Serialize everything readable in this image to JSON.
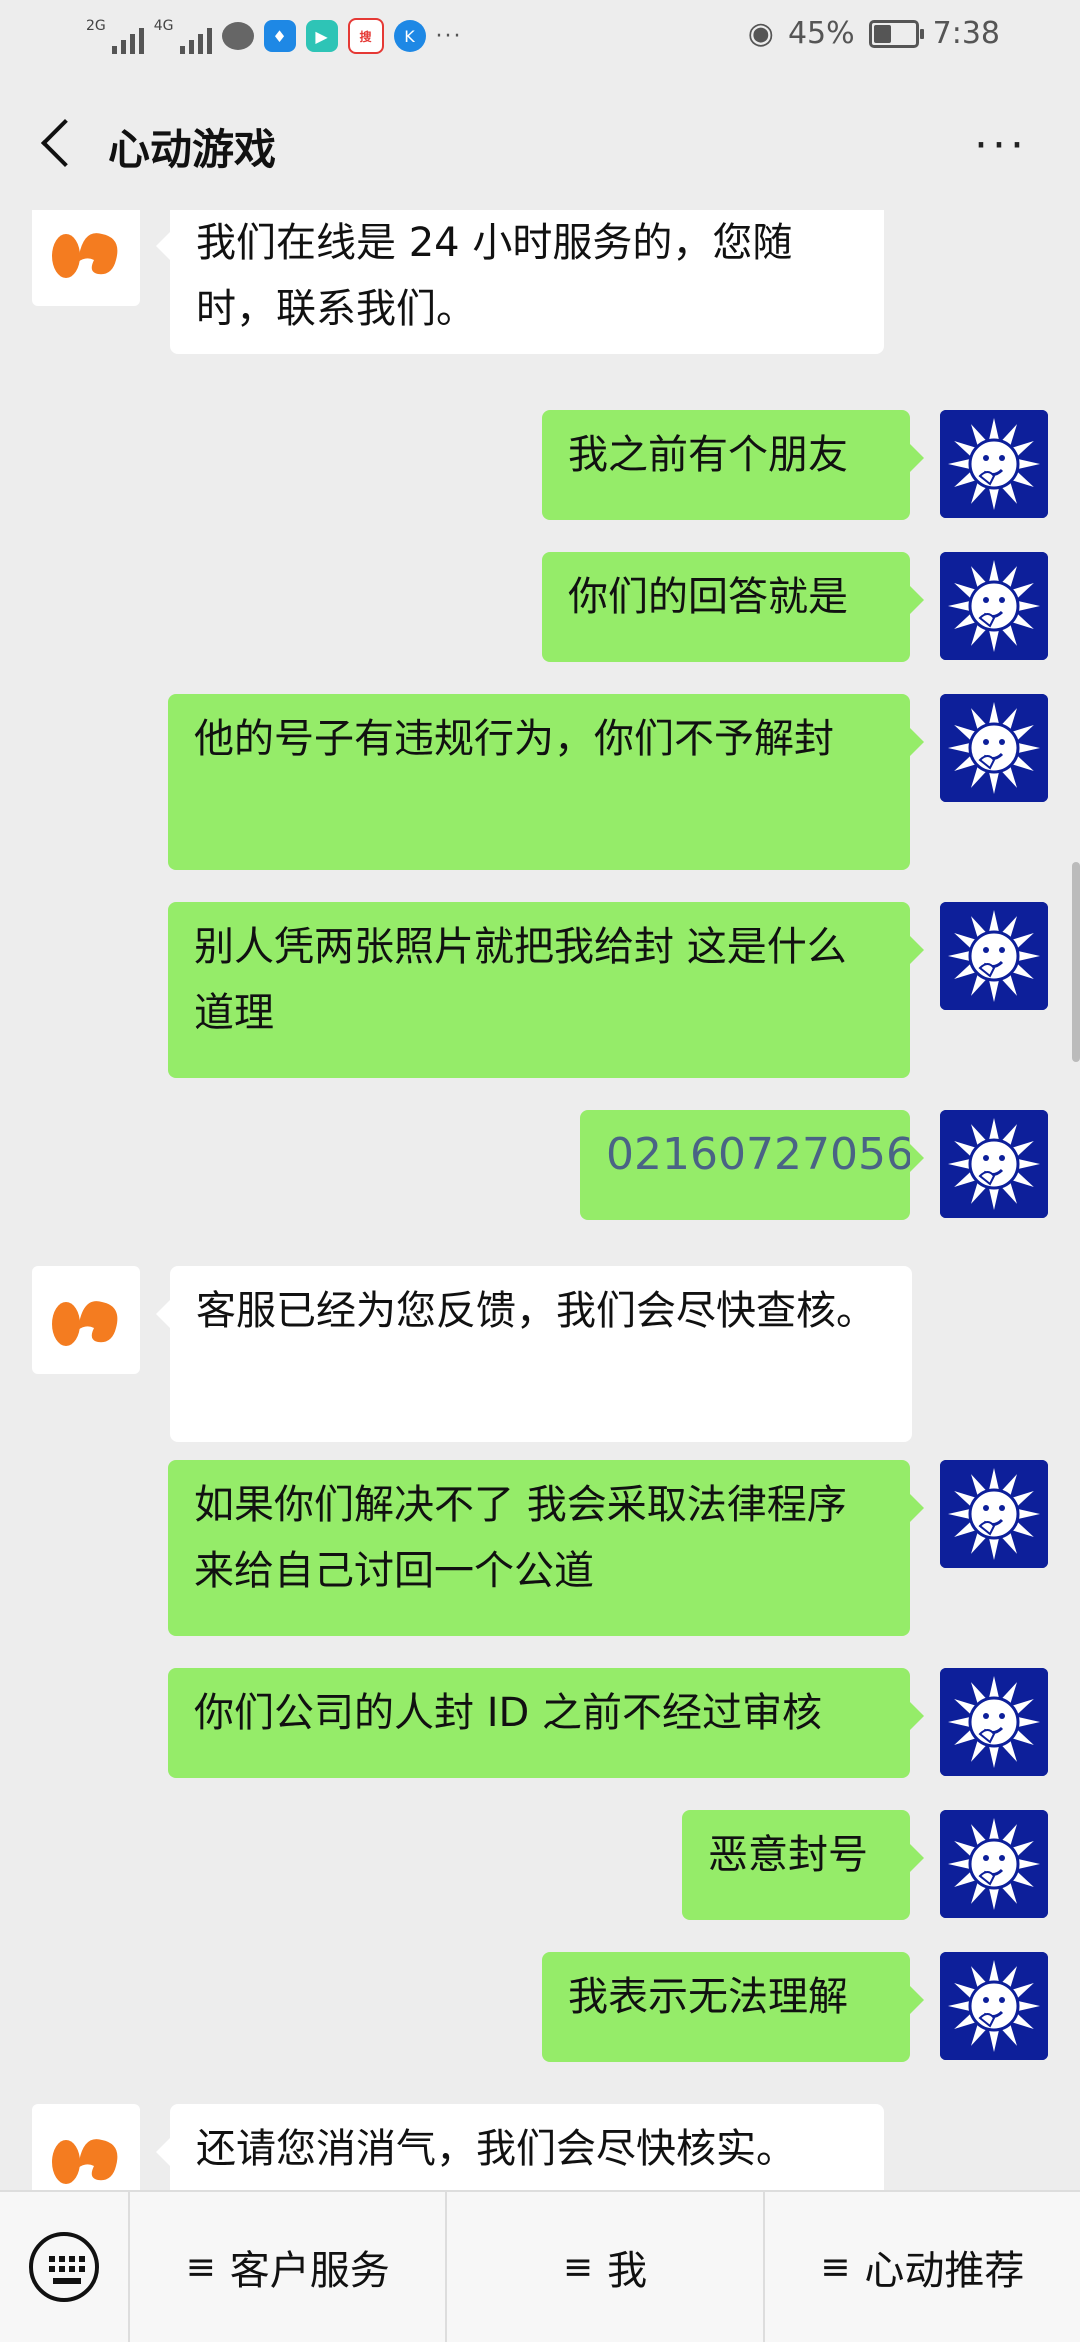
{
  "status": {
    "signal1": "2G",
    "signal2": "4G",
    "battery_pct": "45%",
    "battery_level": 0.45,
    "time": "7:38",
    "more": "···",
    "news_icon_text": "搜狐视频"
  },
  "header": {
    "title": "心动游戏",
    "more_label": "···"
  },
  "messages": [
    {
      "side": "in",
      "text": "我们在线是 24 小时服务的，您随时，联系我们。"
    },
    {
      "side": "out",
      "text": "我之前有个朋友"
    },
    {
      "side": "out",
      "text": "你们的回答就是"
    },
    {
      "side": "out",
      "text": "他的号子有违规行为，你们不予解封"
    },
    {
      "side": "out",
      "text": "别人凭两张照片就把我给封 这是什么道理"
    },
    {
      "side": "out",
      "text": "02160727056"
    },
    {
      "side": "in",
      "text": "客服已经为您反馈，我们会尽快查核。"
    },
    {
      "side": "out",
      "text": "如果你们解决不了 我会采取法律程序来给自己讨回一个公道"
    },
    {
      "side": "out",
      "text": "你们公司的人封 ID 之前不经过审核"
    },
    {
      "side": "out",
      "text": "恶意封号"
    },
    {
      "side": "out",
      "text": "我表示无法理解"
    },
    {
      "side": "in",
      "text": "还请您消消气，我们会尽快核实。"
    }
  ],
  "menu": {
    "items": [
      {
        "label": "客户服务"
      },
      {
        "label": "我"
      },
      {
        "label": "心动推荐"
      }
    ],
    "hamburger": "≡"
  },
  "colors": {
    "background": "#ededed",
    "outgoing_bubble": "#95ec69",
    "incoming_bubble": "#ffffff",
    "bot_logo": "#f47c20",
    "user_avatar": "#0d1f9a"
  }
}
